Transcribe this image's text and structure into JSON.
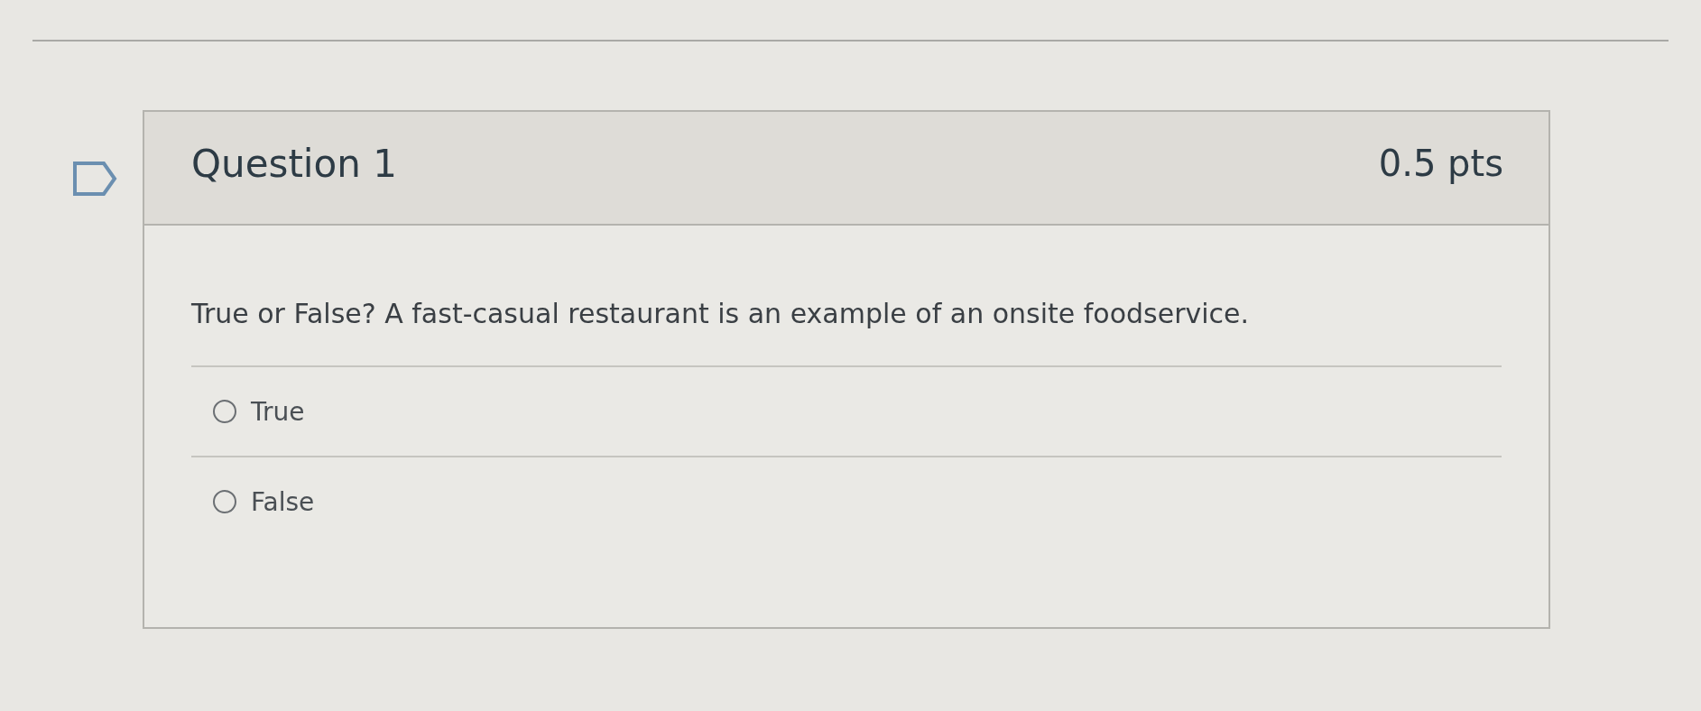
{
  "question": {
    "title": "Question 1",
    "points": "0.5 pts",
    "flagged": false,
    "text": "True or False? A fast-casual restaurant is an example of an onsite foodservice.",
    "answers": [
      {
        "label": "True",
        "selected": false
      },
      {
        "label": "False",
        "selected": false
      }
    ]
  }
}
